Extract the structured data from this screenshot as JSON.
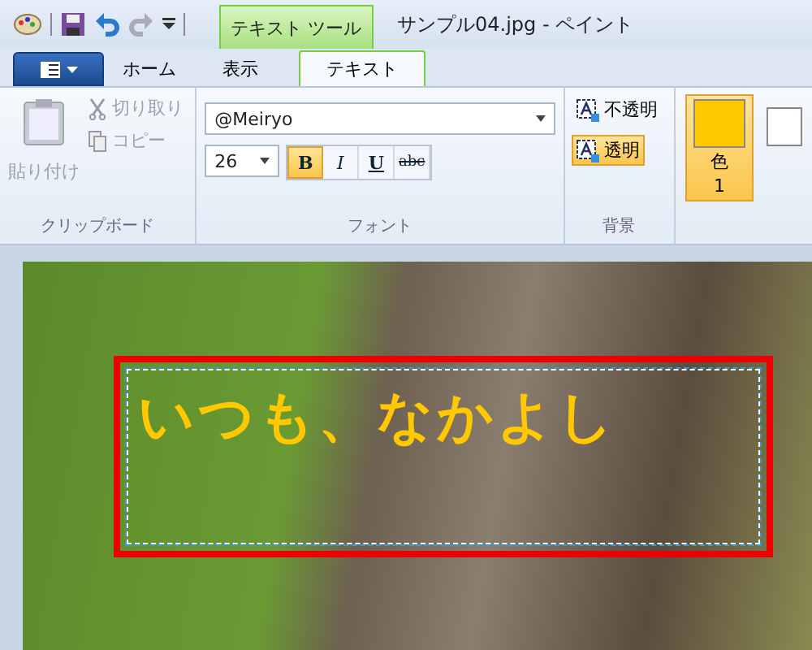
{
  "window": {
    "title": "サンプル04.jpg - ペイント",
    "context_tab": "テキスト ツール"
  },
  "tabs": [
    {
      "label": "ホーム",
      "selected": false
    },
    {
      "label": "表示",
      "selected": false
    },
    {
      "label": "テキスト",
      "selected": true
    }
  ],
  "clipboard": {
    "group": "クリップボード",
    "paste": {
      "label": "貼り付け",
      "disabled": true
    },
    "cut": {
      "label": "切り取り",
      "disabled": true
    },
    "copy": {
      "label": "コピー",
      "disabled": true
    }
  },
  "font": {
    "group": "フォント",
    "family": "@Meiryo",
    "size": "26",
    "styles": [
      {
        "label": "B",
        "kind": "bold",
        "selected": true
      },
      {
        "label": "I",
        "kind": "italic",
        "selected": false
      },
      {
        "label": "U",
        "kind": "underline",
        "selected": false
      },
      {
        "label": "abc",
        "kind": "strike",
        "selected": false
      }
    ]
  },
  "background": {
    "group": "背景",
    "options": [
      {
        "label": "不透明",
        "selected": false
      },
      {
        "label": "透明",
        "selected": true
      }
    ]
  },
  "colors": [
    {
      "label": "色",
      "number": "1",
      "color": "#ffc800",
      "selected": true
    },
    {
      "color": "#ffffff"
    }
  ],
  "canvas": {
    "text": "いつも、なかよし"
  }
}
